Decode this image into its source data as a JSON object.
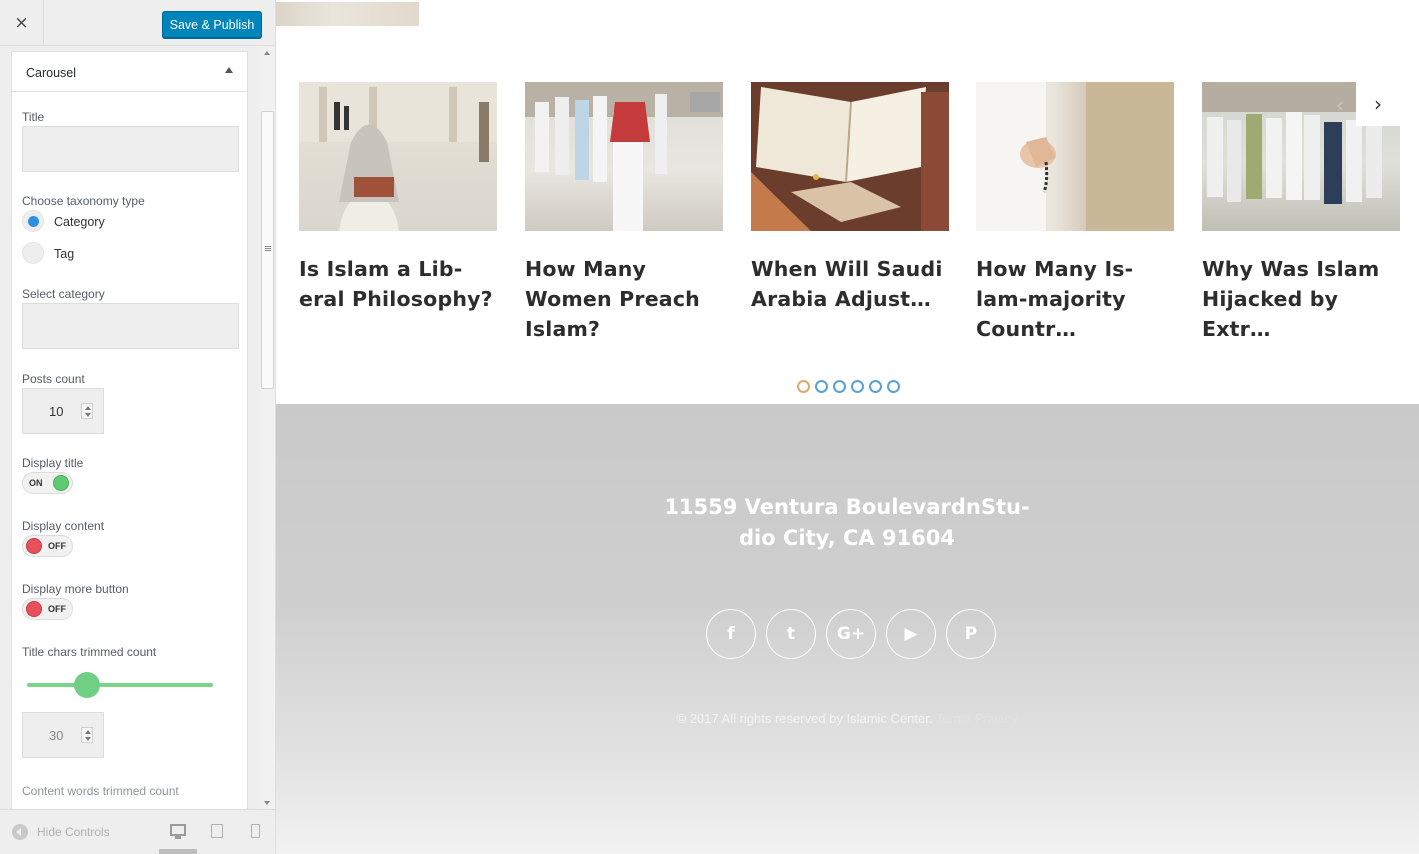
{
  "header": {
    "close_icon": "×",
    "publish_label": "Save & Publish",
    "publish_color": "#0085ba"
  },
  "panel": {
    "title": "Carousel",
    "fields": {
      "title_label": "Title",
      "title_value": "",
      "taxonomy_label": "Choose taxonomy type",
      "taxonomy_options": [
        "Category",
        "Tag"
      ],
      "taxonomy_selected": "Category",
      "category_label": "Select category",
      "category_value": "",
      "posts_count_label": "Posts count",
      "posts_count": "10",
      "display_title_label": "Display title",
      "display_title_state": "ON",
      "display_content_label": "Display content",
      "display_content_state": "OFF",
      "display_more_label": "Display more button",
      "display_more_state": "OFF",
      "title_chars_label": "Title chars trimmed count",
      "title_chars_slider_fraction": 0.32,
      "title_chars_value": "30",
      "content_words_label": "Content words trimmed count"
    }
  },
  "footer_controls": {
    "hide_label": "Hide Controls",
    "devices": [
      "desktop-icon",
      "tablet-icon",
      "mobile-icon"
    ]
  },
  "carousel": {
    "cards": [
      {
        "title": "Is Islam a Lib-\neral Philosophy?"
      },
      {
        "title": "How Many\nWomen Preach\nIslam?"
      },
      {
        "title": "When Will Saudi\nArabia Adjust…"
      },
      {
        "title": "How Many Is-\nlam-majority\nCountr…"
      },
      {
        "title": "Why Was Islam\nHijacked by\nExtr…"
      }
    ],
    "prev_icon": "‹",
    "next_icon": "›",
    "dots_count": 6,
    "active_dot": 0
  },
  "site_footer": {
    "address": "11559 Ventura BoulevardnStu-\ndio City, CA 91604",
    "socials": [
      {
        "name": "facebook-icon",
        "glyph": "f"
      },
      {
        "name": "twitter-icon",
        "glyph": "t"
      },
      {
        "name": "google-plus-icon",
        "glyph": "G+"
      },
      {
        "name": "youtube-icon",
        "glyph": "▶"
      },
      {
        "name": "pinterest-icon",
        "glyph": "P"
      }
    ],
    "copyright": "© 2017 All rights reserved by Islamic Center.",
    "links": "Terms Privacy"
  }
}
